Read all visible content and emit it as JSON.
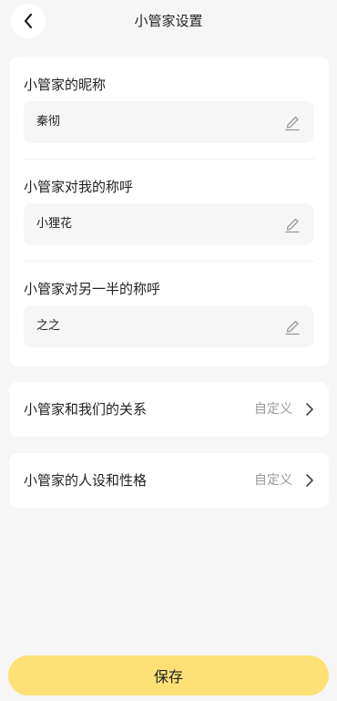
{
  "header": {
    "title": "小管家设置",
    "back_icon": "chevron-left-icon"
  },
  "names_card": {
    "fields": [
      {
        "label": "小管家的昵称",
        "value": "秦彻",
        "icon": "edit-pencil-icon"
      },
      {
        "label": "小管家对我的称呼",
        "value": "小狸花",
        "icon": "edit-pencil-icon"
      },
      {
        "label": "小管家对另一半的称呼",
        "value": "之之",
        "icon": "edit-pencil-icon"
      }
    ]
  },
  "settings_rows": [
    {
      "label": "小管家和我们的关系",
      "value": "自定义",
      "icon": "chevron-right-icon"
    },
    {
      "label": "小管家的人设和性格",
      "value": "自定义",
      "icon": "chevron-right-icon"
    }
  ],
  "footer": {
    "save_label": "保存"
  },
  "colors": {
    "background": "#f6f6f6",
    "card": "#ffffff",
    "input_bg": "#f6f6f6",
    "accent": "#fde177",
    "secondary_text": "#999999"
  }
}
